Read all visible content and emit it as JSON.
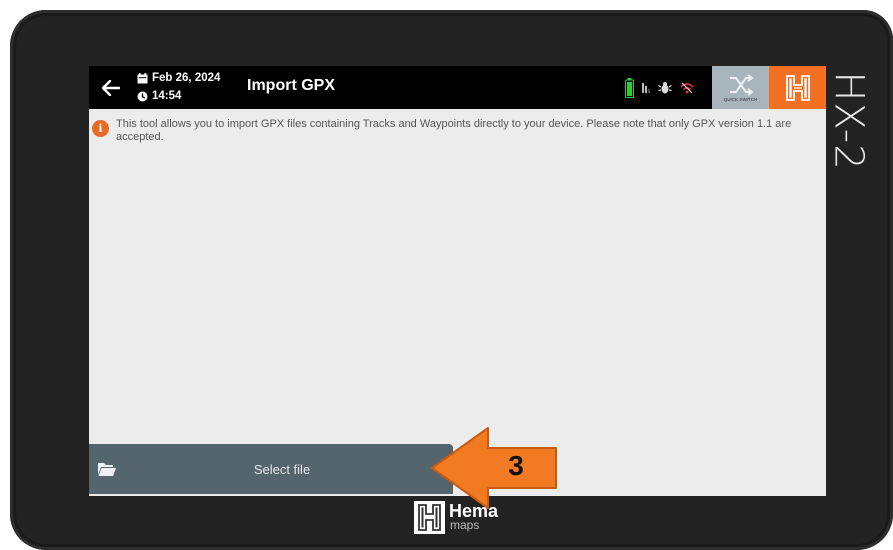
{
  "device": {
    "brand": "HX-2"
  },
  "header": {
    "date": "Feb 26, 2024",
    "time": "14:54",
    "title": "Import GPX",
    "quick_switch_label": "QUICK SWITCH"
  },
  "status_icons": [
    "battery-icon",
    "signal-icon",
    "bug-icon",
    "wifi-icon"
  ],
  "info": {
    "message": "This tool allows you to import GPX files containing Tracks and Waypoints directly to your device. Please note that only GPX version 1.1 are accepted."
  },
  "actions": {
    "select_file": "Select file"
  },
  "annotation": {
    "step_number": "3"
  },
  "footer": {
    "logo_word": "Hema",
    "logo_sub": "maps"
  },
  "colors": {
    "accent": "#f36f21",
    "bar": "#000000",
    "button": "#55656e",
    "screen": "#ececec",
    "quick_switch": "#a7b4bc"
  }
}
